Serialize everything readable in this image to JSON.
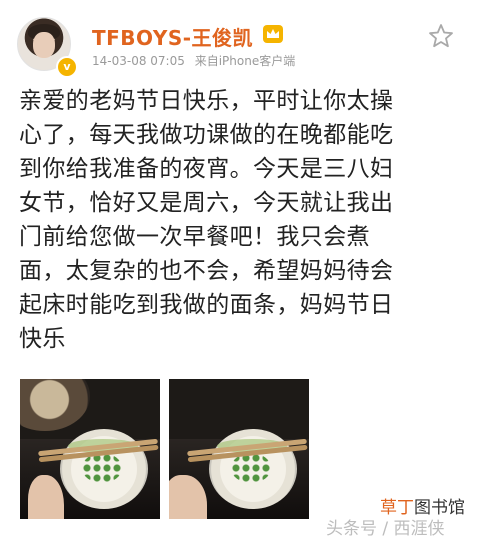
{
  "header": {
    "username": "TFBOYS-王俊凯",
    "date": "14-03-08 07:05",
    "source": "来自iPhone客户端",
    "badge": "v"
  },
  "content": {
    "lines": [
      "亲爱的老妈节日快乐，平时让你太操",
      "心了，每天我做功课做的在晚都能吃",
      "到你给我准备的夜宵。今天是三八妇",
      "女节，恰好又是周六，今天就让我出",
      "门前给您做一次早餐吧！我只会煮",
      "面，太复杂的也不会，希望妈妈待会",
      "起床时能吃到我做的面条，妈妈节日",
      "快乐"
    ]
  },
  "watermark": {
    "library_a": "草丁",
    "library_b": "图书馆",
    "source": "头条号 / 西涯侠"
  },
  "icons": {
    "star": "star-outline-icon",
    "crown": "crown-icon"
  },
  "colors": {
    "accent": "#e0641f",
    "text": "#222222",
    "meta": "#9a9a9a"
  }
}
